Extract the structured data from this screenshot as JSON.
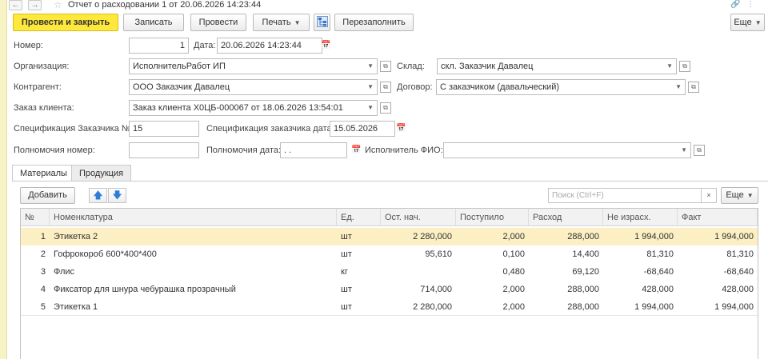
{
  "window": {
    "title": "Отчет о расходовании 1 от 20.06.2026 14:23:44",
    "back": "←",
    "forward": "→",
    "star": "☆",
    "link": "🔗",
    "menu": "⋮"
  },
  "toolbar": {
    "post_close": "Провести и закрыть",
    "save": "Записать",
    "post": "Провести",
    "print": "Печать",
    "refill": "Перезаполнить",
    "more": "Еще"
  },
  "form": {
    "number": {
      "label": "Номер:",
      "value": "1"
    },
    "date": {
      "label": "Дата:",
      "value": "20.06.2026 14:23:44"
    },
    "organization": {
      "label": "Организация:",
      "value": "ИсполнительРабот ИП"
    },
    "warehouse": {
      "label": "Склад:",
      "value": "скл. Заказчик Давалец"
    },
    "counterparty": {
      "label": "Контрагент:",
      "value": "ООО Заказчик Давалец"
    },
    "contract": {
      "label": "Договор:",
      "value": "С заказчиком (давальческий)"
    },
    "client_order": {
      "label": "Заказ клиента:",
      "value": "Заказ клиента Х0ЦБ-000067 от 18.06.2026 13:54:01"
    },
    "spec_number": {
      "label": "Спецификация Заказчика №:",
      "value": "15"
    },
    "spec_date": {
      "label": "Спецификация заказчика дата:",
      "value": "15.05.2026"
    },
    "authority_number": {
      "label": "Полномочия номер:",
      "value": ""
    },
    "authority_date": {
      "label": "Полномочия дата:",
      "value": " .  ."
    },
    "executor": {
      "label": "Исполнитель ФИО:",
      "value": ""
    }
  },
  "tabs": [
    {
      "label": "Материалы",
      "active": true
    },
    {
      "label": "Продукция",
      "active": false
    }
  ],
  "table_toolbar": {
    "add": "Добавить",
    "search_placeholder": "Поиск (Ctrl+F)",
    "clear": "×",
    "more": "Еще"
  },
  "table": {
    "headers": [
      "№",
      "Номенклатура",
      "Ед.",
      "Ост. нач.",
      "Поступило",
      "Расход",
      "Не израсх.",
      "Факт"
    ],
    "rows": [
      [
        "1",
        "Этикетка 2",
        "шт",
        "2 280,000",
        "2,000",
        "288,000",
        "1 994,000",
        "1 994,000"
      ],
      [
        "2",
        "Гофрокороб 600*400*400",
        "шт",
        "95,610",
        "0,100",
        "14,400",
        "81,310",
        "81,310"
      ],
      [
        "3",
        "Флис",
        "кг",
        "",
        "0,480",
        "69,120",
        "-68,640",
        "-68,640"
      ],
      [
        "4",
        "Фиксатор для шнура чебурашка прозрачный",
        "шт",
        "714,000",
        "2,000",
        "288,000",
        "428,000",
        "428,000"
      ],
      [
        "5",
        "Этикетка 1",
        "шт",
        "2 280,000",
        "2,000",
        "288,000",
        "1 994,000",
        "1 994,000"
      ]
    ],
    "selected_row": 0
  },
  "colors": {
    "primary": "#fde83b",
    "selected_row": "#fbefc3",
    "header_bg": "#f2f2f2",
    "sidebar": "#f8f3c4"
  }
}
